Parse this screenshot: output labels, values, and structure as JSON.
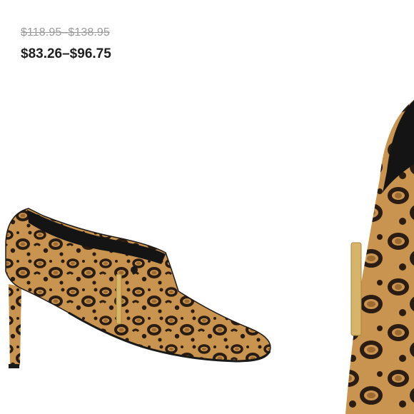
{
  "pricing": {
    "original_price": "$118.95–$138.95",
    "sale_price": "$83.26–$96.75"
  },
  "product": {
    "image_icon": "leopard-print-bootie",
    "zoom_icon": "leopard-print-bootie-closeup"
  },
  "colors": {
    "sale_text": "#1f1f1f",
    "strike_text": "#9a9a9a",
    "leopard_base": "#c8944f",
    "leopard_spot": "#2a1c12",
    "hardware_gold": "#d6b46a"
  }
}
